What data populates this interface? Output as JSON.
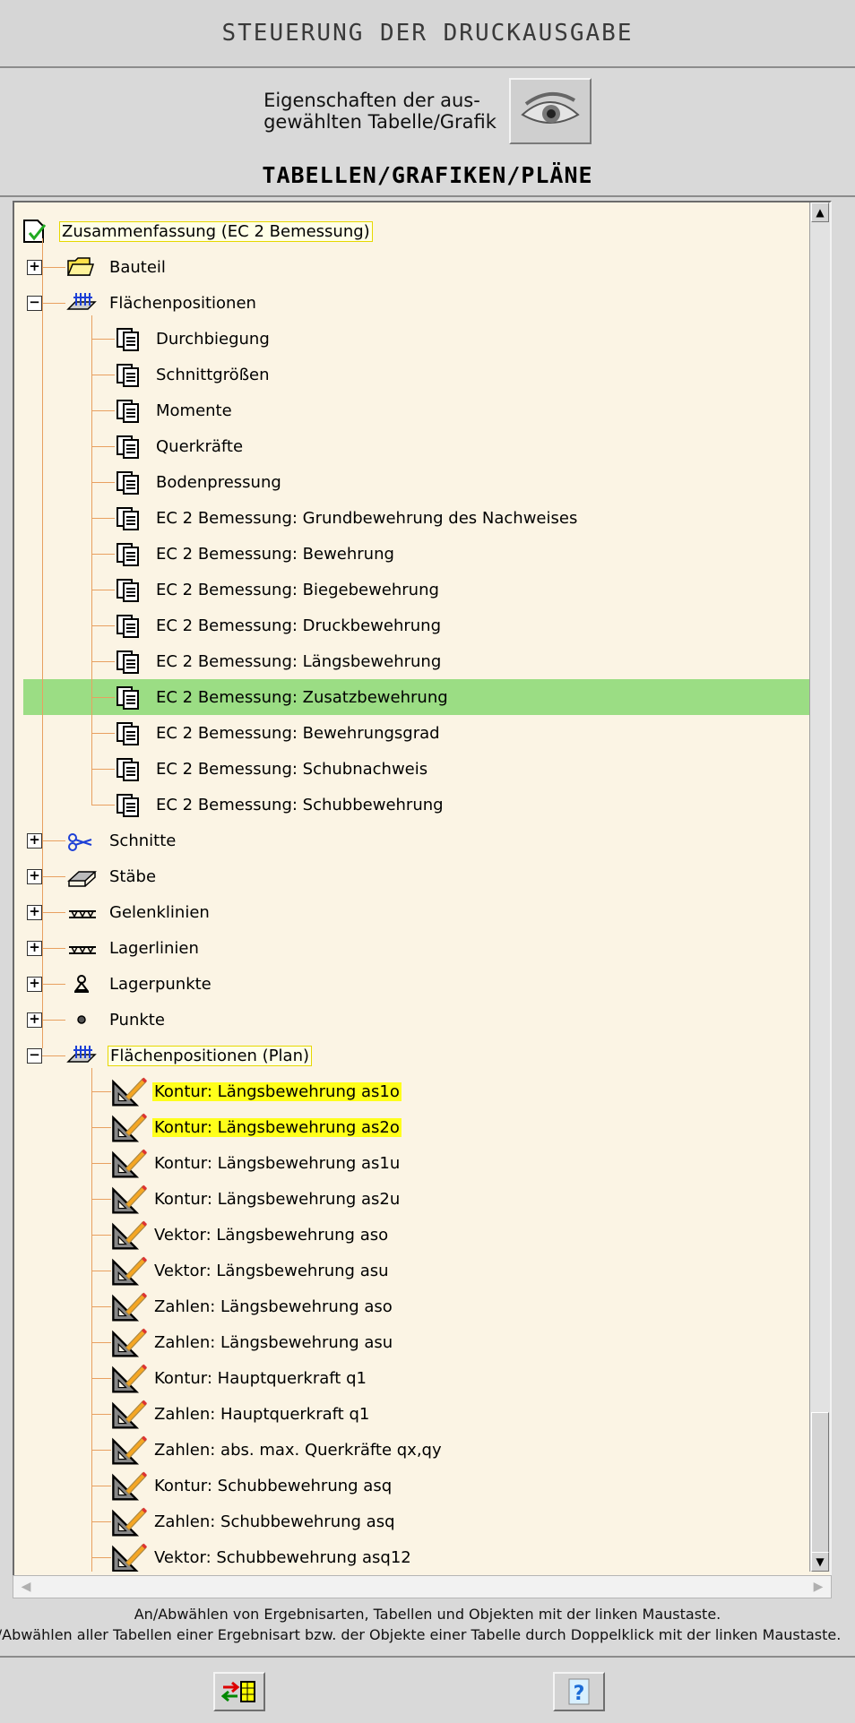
{
  "header": {
    "title": "STEUERUNG DER DRUCKAUSGABE",
    "props_line1": "Eigenschaften der aus-",
    "props_line2": "gewählten Tabelle/Grafik",
    "section_title": "TABELLEN/GRAFIKEN/PLÄNE"
  },
  "tree": {
    "root": {
      "label": "Zusammenfassung (EC 2 Bemessung)",
      "icon": "summary-doc-icon"
    },
    "bauteil": {
      "label": "Bauteil",
      "icon": "folder-icon",
      "expanded": false
    },
    "flaechen": {
      "label": "Flächenpositionen",
      "icon": "surface-position-icon",
      "expanded": true,
      "children": [
        "Durchbiegung",
        "Schnittgrößen",
        "Momente",
        "Querkräfte",
        "Bodenpressung",
        "EC 2 Bemessung: Grundbewehrung des Nachweises",
        "EC 2 Bemessung: Bewehrung",
        "EC 2 Bemessung: Biegebewehrung",
        "EC 2 Bemessung: Druckbewehrung",
        "EC 2 Bemessung: Längsbewehrung",
        "EC 2 Bemessung: Zusatzbewehrung",
        "EC 2 Bemessung: Bewehrungsgrad",
        "EC 2 Bemessung: Schubnachweis",
        "EC 2 Bemessung: Schubbewehrung"
      ],
      "selected_index": 10
    },
    "groups": [
      {
        "label": "Schnitte",
        "icon": "scissors-icon"
      },
      {
        "label": "Stäbe",
        "icon": "beam-icon"
      },
      {
        "label": "Gelenklinien",
        "icon": "hinge-line-icon"
      },
      {
        "label": "Lagerlinien",
        "icon": "support-line-icon"
      },
      {
        "label": "Lagerpunkte",
        "icon": "support-point-icon"
      },
      {
        "label": "Punkte",
        "icon": "point-icon"
      }
    ],
    "plan": {
      "label": "Flächenpositionen (Plan)",
      "icon": "surface-position-icon",
      "expanded": true,
      "children": [
        "Kontur: Längsbewehrung as1o",
        "Kontur: Längsbewehrung as2o",
        "Kontur: Längsbewehrung as1u",
        "Kontur: Längsbewehrung as2u",
        "Vektor: Längsbewehrung aso",
        "Vektor: Längsbewehrung asu",
        "Zahlen: Längsbewehrung aso",
        "Zahlen: Längsbewehrung asu",
        "Kontur: Hauptquerkraft q1",
        "Zahlen: Hauptquerkraft q1",
        "Zahlen: abs. max. Querkräfte qx,qy",
        "Kontur: Schubbewehrung asq",
        "Zahlen: Schubbewehrung asq",
        "Vektor: Schubbewehrung asq12"
      ],
      "highlighted": [
        0,
        1
      ]
    }
  },
  "status": {
    "line1": "An/Abwählen von Ergebnisarten, Tabellen und Objekten mit der linken Maustaste.",
    "line2": "An/Abwählen aller Tabellen einer Ergebnisart bzw. der Objekte einer Tabelle durch Doppelklick mit der linken Maustaste."
  },
  "toolbar": {
    "toggle_icon": "select-toggle-icon",
    "help_icon": "help-icon"
  },
  "colors": {
    "tree_bg": "#fbf4e4",
    "selection": "#9bdd84",
    "highlight": "#ffff1a",
    "line": "#e8a060"
  }
}
